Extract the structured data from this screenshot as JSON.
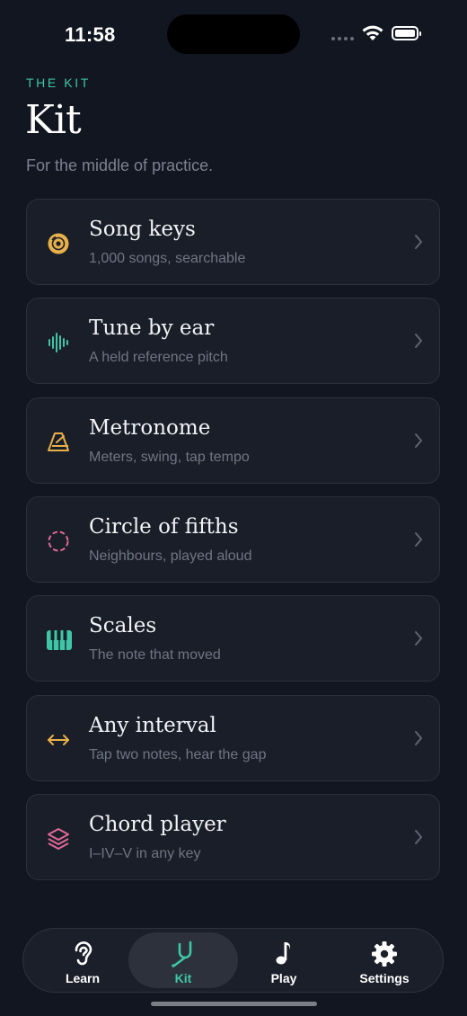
{
  "status": {
    "time": "11:58"
  },
  "header": {
    "eyebrow": "THE KIT",
    "title": "Kit",
    "subtitle": "For the middle of practice."
  },
  "items": [
    {
      "label": "Song keys",
      "desc": "1,000 songs, searchable",
      "icon": "disc-icon",
      "color": "#e8b04a"
    },
    {
      "label": "Tune by ear",
      "desc": "A held reference pitch",
      "icon": "waveform-icon",
      "color": "#3fc6a6"
    },
    {
      "label": "Metronome",
      "desc": "Meters, swing, tap tempo",
      "icon": "metronome-icon",
      "color": "#e8b04a"
    },
    {
      "label": "Circle of fifths",
      "desc": "Neighbours, played aloud",
      "icon": "dashed-circle-icon",
      "color": "#e0689a"
    },
    {
      "label": "Scales",
      "desc": "The note that moved",
      "icon": "piano-keys-icon",
      "color": "#3fc6a6"
    },
    {
      "label": "Any interval",
      "desc": "Tap two notes, hear the gap",
      "icon": "double-arrow-icon",
      "color": "#e8b04a"
    },
    {
      "label": "Chord player",
      "desc": "I–IV–V in any key",
      "icon": "stack-icon",
      "color": "#e0689a"
    }
  ],
  "tabs": [
    {
      "label": "Learn",
      "icon": "ear-icon",
      "active": false
    },
    {
      "label": "Kit",
      "icon": "tuning-fork-icon",
      "active": true
    },
    {
      "label": "Play",
      "icon": "music-note-icon",
      "active": false
    },
    {
      "label": "Settings",
      "icon": "gear-icon",
      "active": false
    }
  ],
  "colors": {
    "accent": "#3fc6a6",
    "background": "#111620",
    "card": "#1a1e28"
  }
}
